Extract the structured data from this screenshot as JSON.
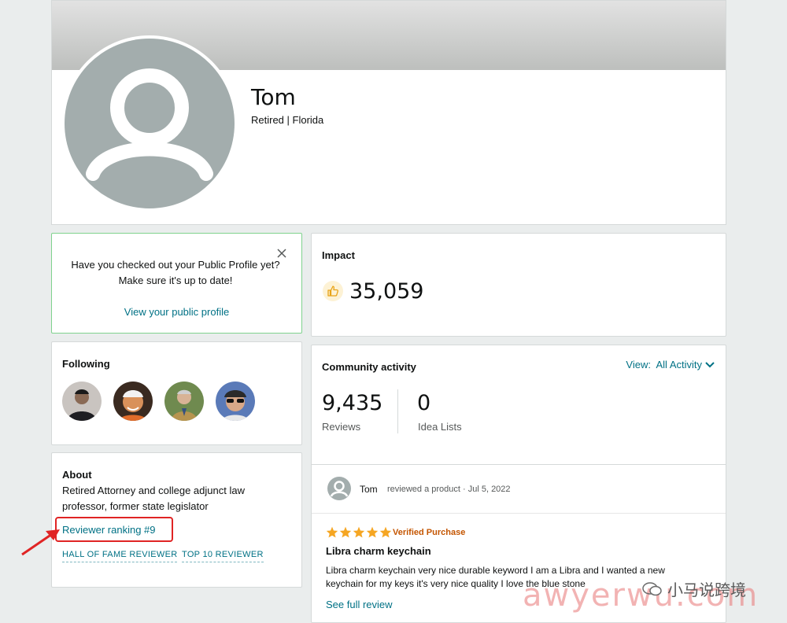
{
  "profile": {
    "name": "Tom",
    "subtitle": "Retired | Florida"
  },
  "notice": {
    "text": "Have you checked out your Public Profile yet? Make sure it's up to date!",
    "link": "View your public profile",
    "close_icon": "close-icon"
  },
  "impact": {
    "label": "Impact",
    "value": "35,059",
    "icon": "thumbs-up-icon"
  },
  "following": {
    "label": "Following",
    "count_shown": 4
  },
  "about": {
    "label": "About",
    "text": "Retired Attorney and college adjunct law professor, former state legislator",
    "ranking": "Reviewer ranking #9",
    "badges": [
      "HALL OF FAME REVIEWER",
      "TOP 10 REVIEWER"
    ]
  },
  "community": {
    "label": "Community activity",
    "view_filter": "View:  All Activity",
    "stats": [
      {
        "value": "9,435",
        "label": "Reviews"
      },
      {
        "value": "0",
        "label": "Idea Lists"
      }
    ],
    "post": {
      "author": "Tom",
      "meta": "reviewed a product · Jul 5, 2022",
      "rating": 5,
      "verified": "Verified Purchase",
      "product_title": "Libra charm keychain",
      "review_text": "Libra charm keychain very nice durable keyword I am a Libra and I wanted a new keychain for my keys it's very nice quality I love the blue stone",
      "see_full": "See full review"
    }
  },
  "watermark": {
    "cn": "小马说跨境",
    "en": "awyerwu.com"
  },
  "colors": {
    "link": "#007185",
    "star": "#f5a623",
    "verified": "#c45500",
    "highlight": "#e02424"
  }
}
